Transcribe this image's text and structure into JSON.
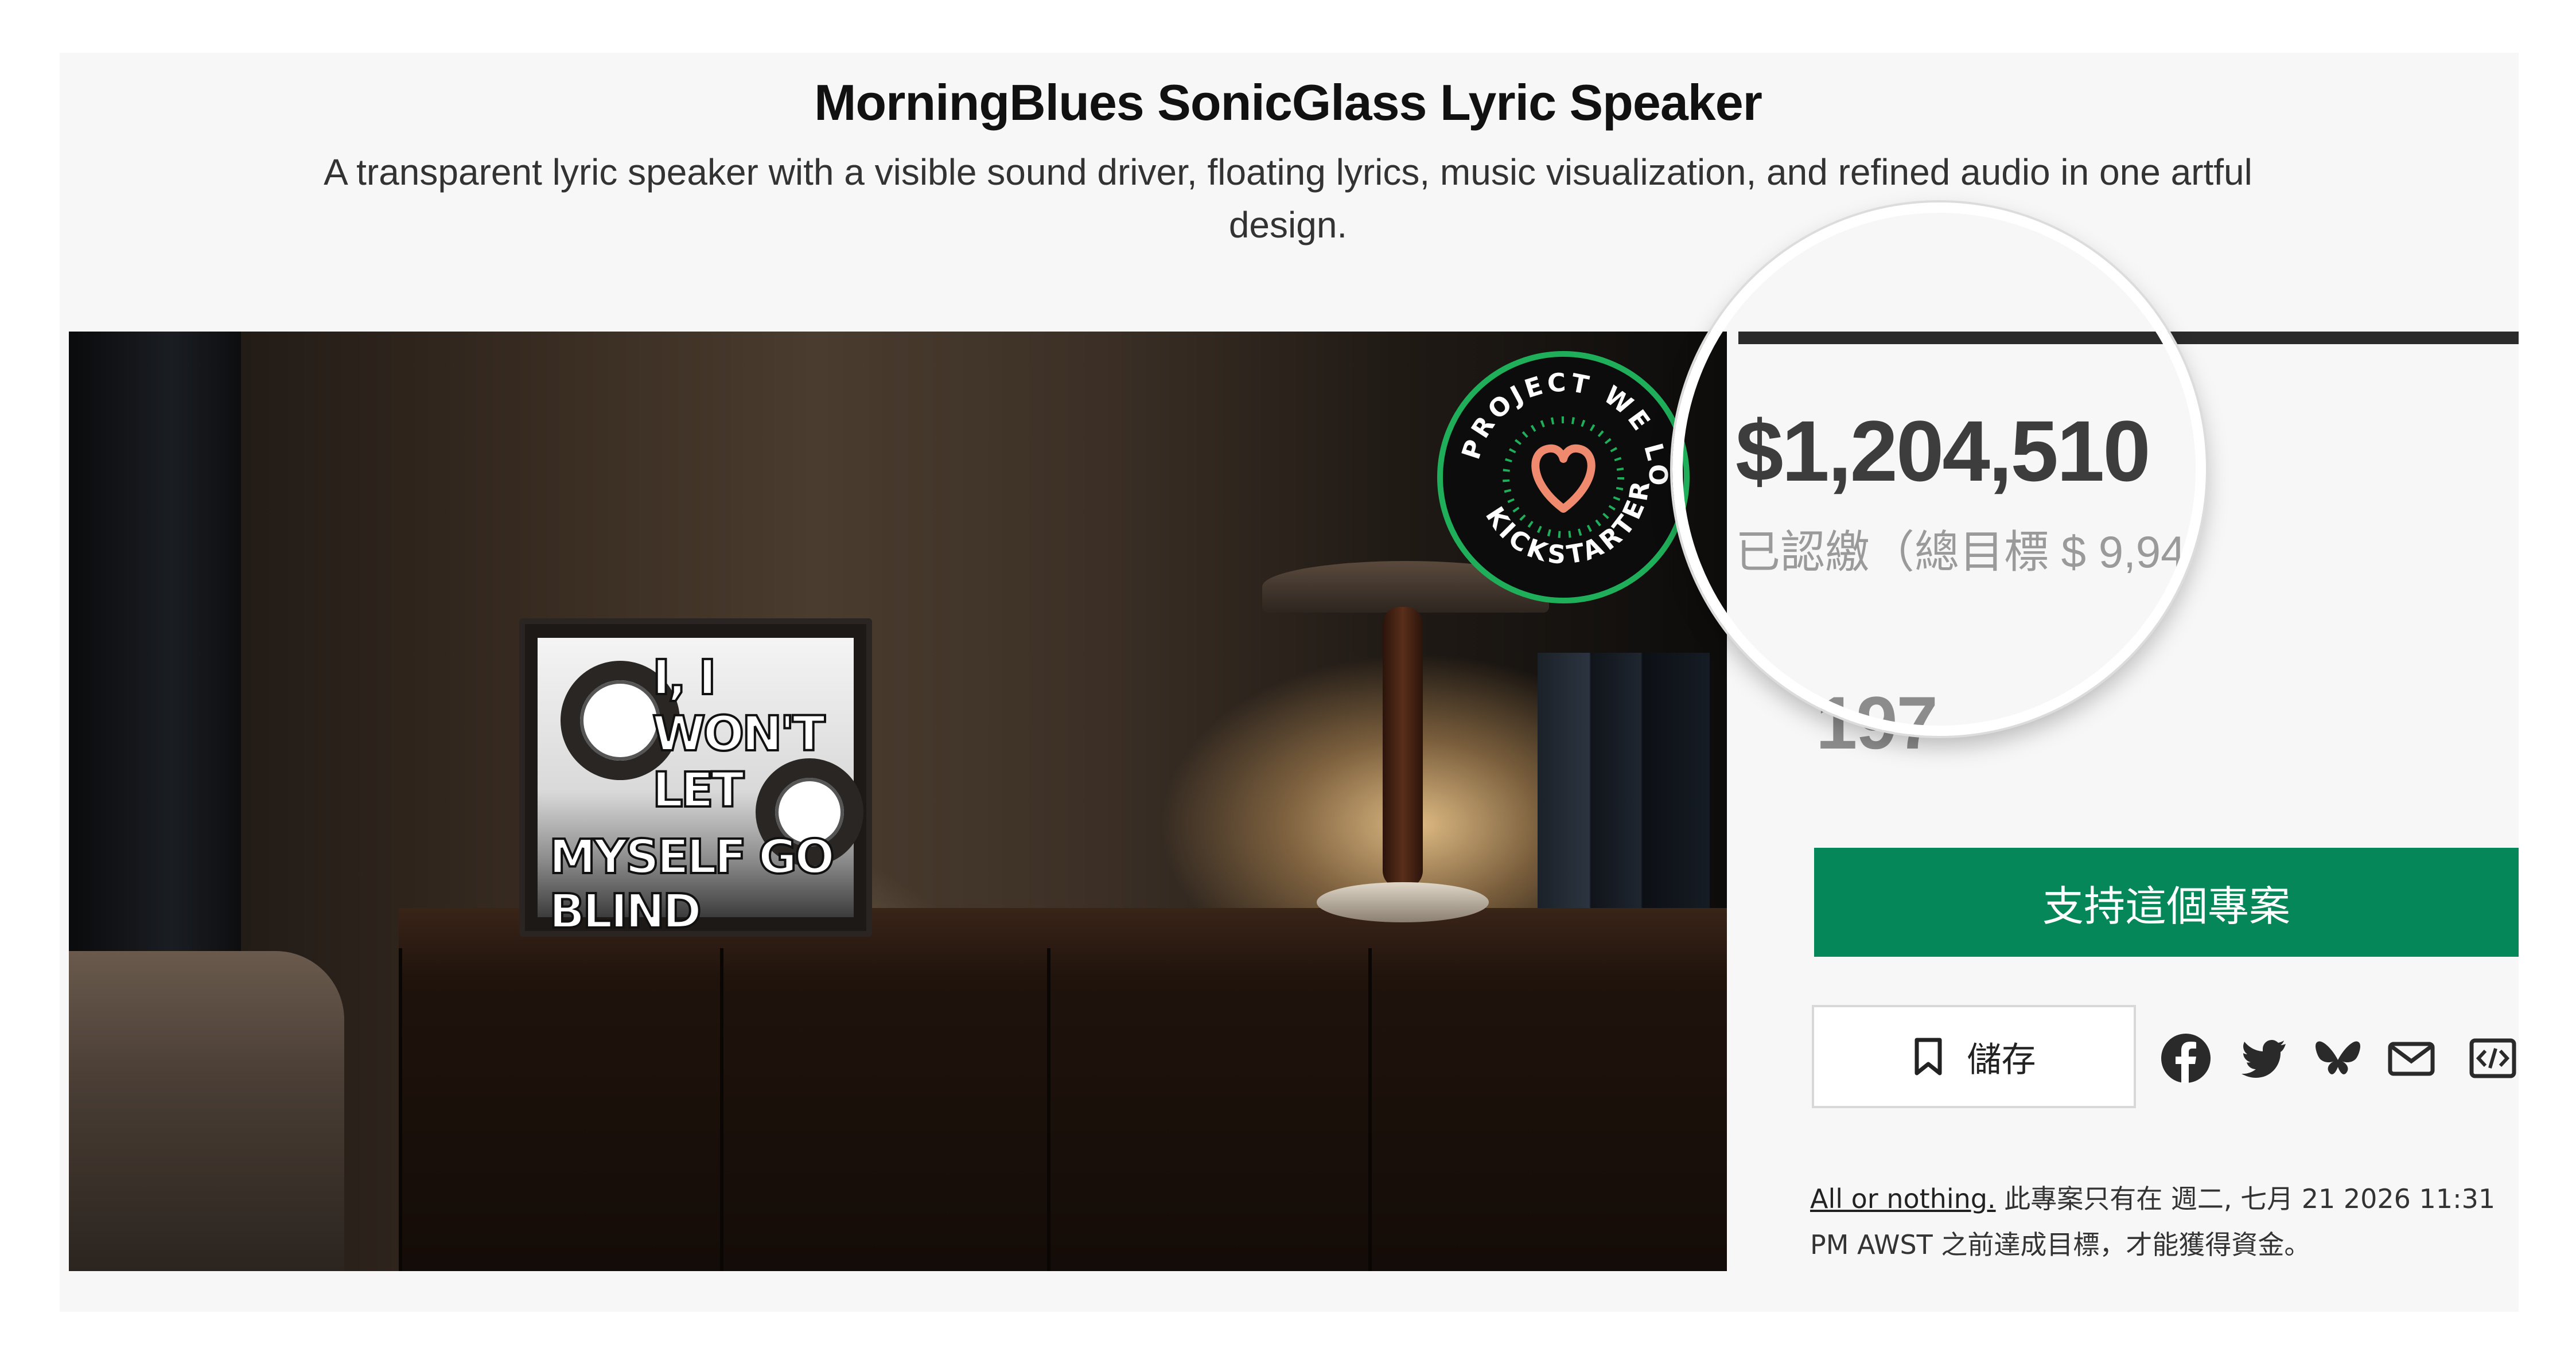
{
  "project": {
    "title": "MorningBlues SonicGlass Lyric Speaker",
    "subtitle": "A transparent lyric speaker with a visible sound driver, floating lyrics, music visualization, and refined audio in one artful design."
  },
  "hero": {
    "lyric_line_1": "I, I WON'T LET",
    "lyric_line_2": "MYSELF GO BLIND",
    "badge_text": "PROJECT WE LOVE · KICKSTARTER"
  },
  "stats": {
    "pledged": "$1,204,510",
    "goal_label": "已認繳（總目標 $ 9,94",
    "backers_partial": "197"
  },
  "actions": {
    "back_label": "支持這個專案",
    "save_label": "儲存"
  },
  "funding_note": {
    "link": "All or nothing.",
    "text": " 此專案只有在 週二, 七月 21 2026 11:31 PM AWST 之前達成目標，才能獲得資金。"
  },
  "colors": {
    "primary_green": "#05875a",
    "badge_green": "#1faf5a",
    "heart": "#f08a6e"
  },
  "icons": [
    "bookmark-icon",
    "facebook-icon",
    "twitter-icon",
    "bluesky-icon",
    "email-icon",
    "embed-icon"
  ]
}
